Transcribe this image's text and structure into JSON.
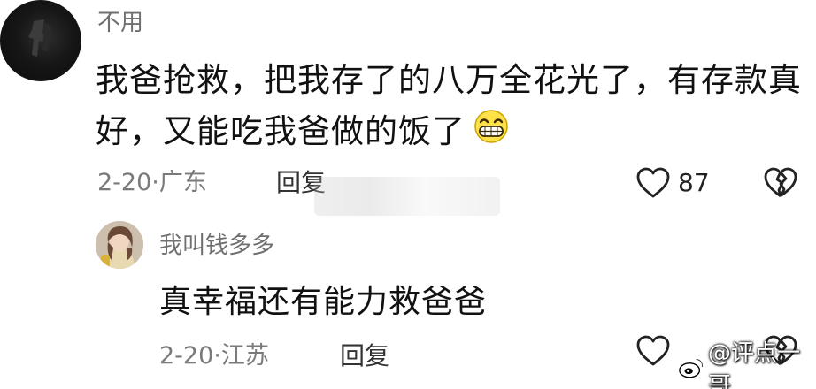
{
  "main_comment": {
    "username": "不用",
    "text": "我爸抢救，把我存了的八万全花光了，有存款真好，又能吃我爸做的饭了",
    "emoji": "grinning-face-emoji",
    "date_location": "2-20·广东",
    "reply_label": "回复",
    "like_count": "87"
  },
  "reply_comment": {
    "username": "我叫钱多多",
    "text": "真幸福还有能力救爸爸",
    "date_location": "2-20·江苏",
    "reply_label": "回复"
  },
  "watermark": {
    "text": "@评点一哥"
  },
  "icons": {
    "like": "heart-outline-icon",
    "dislike": "broken-heart-outline-icon",
    "watermark": "weibo-logo-icon"
  },
  "colors": {
    "text_primary": "#111111",
    "text_secondary": "#7a7a7a",
    "username": "#6f6f6f"
  }
}
